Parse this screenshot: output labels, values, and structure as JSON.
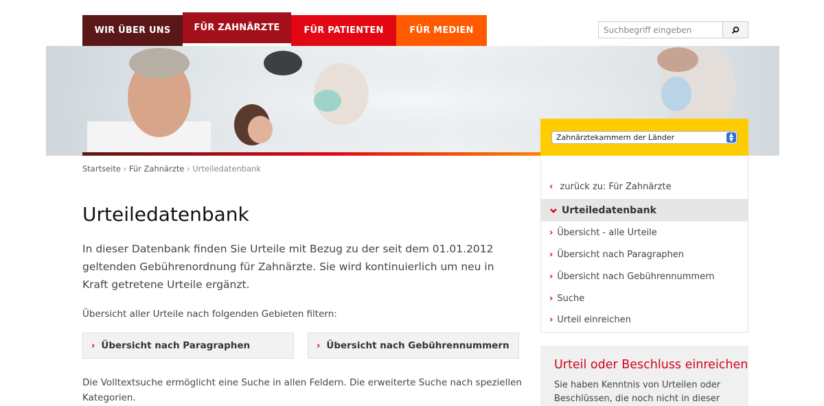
{
  "nav": {
    "tabs": [
      {
        "label": "WIR ÜBER UNS"
      },
      {
        "label": "FÜR ZAHNÄRZTE"
      },
      {
        "label": "FÜR PATIENTEN"
      },
      {
        "label": "FÜR MEDIEN"
      }
    ],
    "active_index": 1
  },
  "search": {
    "placeholder": "Suchbegriff eingeben",
    "button_icon": "search-icon"
  },
  "hero": {
    "laender_select_value": "Zahnärztekammern der Länder"
  },
  "breadcrumb": {
    "items": [
      "Startseite",
      "Für Zahnärzte",
      "Urteiledatenbank"
    ],
    "separator": "›"
  },
  "main": {
    "title": "Urteiledatenbank",
    "lead": "In dieser Datenbank finden Sie Urteile mit Bezug zu der seit dem 01.01.2012 geltenden Gebührenordnung für Zahnärzte. Sie wird kontinuierlich um neu in Kraft getretene Urteile ergänzt.",
    "filter_label": "Übersicht aller Urteile nach folgenden Gebieten filtern:",
    "filter_buttons": [
      {
        "label": "Übersicht nach Paragraphen"
      },
      {
        "label": "Übersicht nach Gebührennummern"
      }
    ],
    "fulltext": "Die Volltextsuche ermöglicht eine Suche in allen Feldern. Die erweiterte Suche nach speziellen Kategorien."
  },
  "sidebar": {
    "back_label": "zurück zu: Für Zahnärzte",
    "active_label": "Urteiledatenbank",
    "items": [
      {
        "label": "Übersicht - alle Urteile"
      },
      {
        "label": "Übersicht nach Paragraphen"
      },
      {
        "label": "Übersicht nach Gebührennummern"
      },
      {
        "label": "Suche"
      },
      {
        "label": "Urteil einreichen"
      }
    ]
  },
  "submit_box": {
    "heading": "Urteil oder Beschluss einreichen",
    "text": "Sie haben Kenntnis von Urteilen oder Beschlüssen, die noch nicht in dieser"
  },
  "colors": {
    "nav_1": "#5a1717",
    "nav_2": "#a30f1a",
    "nav_3": "#e30613",
    "nav_4": "#ff5a00",
    "accent_red": "#d0021b",
    "yellow": "#ffcc00"
  }
}
